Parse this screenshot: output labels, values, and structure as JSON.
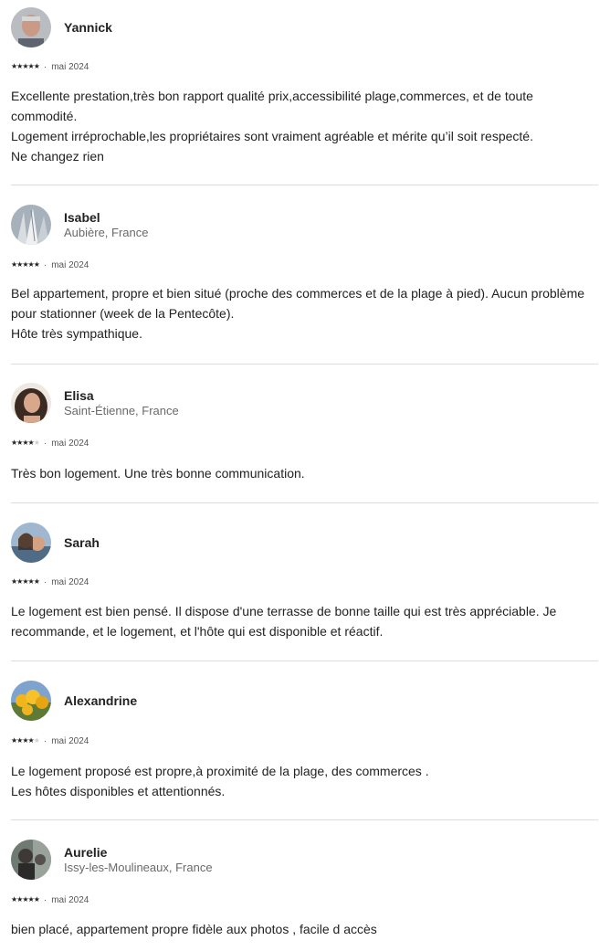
{
  "reviews": [
    {
      "name": "Yannick",
      "location": "",
      "rating": 5,
      "date": "mai 2024",
      "avatar": "person-photo",
      "text": [
        "Excellente prestation,très bon rapport qualité prix,accessibilité plage,commerces, et de toute commodité.",
        "Logement irréprochable,les propriétaires sont vraiment agréable et mérite qu’il soit respecté.",
        "Ne changez rien"
      ]
    },
    {
      "name": "Isabel",
      "location": "Aubière, France",
      "rating": 5,
      "date": "mai 2024",
      "avatar": "winter-tree-photo",
      "text": [
        "Bel appartement, propre et bien situé (proche des commerces et de la plage à pied). Aucun problème pour stationner (week de la Pentecôte).",
        "Hôte très sympathique."
      ]
    },
    {
      "name": "Elisa",
      "location": "Saint-Étienne, France",
      "rating": 4,
      "date": "mai 2024",
      "avatar": "person-photo",
      "text": [
        "Très bon logement. Une très bonne communication."
      ]
    },
    {
      "name": "Sarah",
      "location": "",
      "rating": 5,
      "date": "mai 2024",
      "avatar": "couple-photo",
      "text": [
        "Le logement est bien pensé. Il dispose d'une terrasse de bonne taille qui est très appréciable. Je recommande, et le logement, et l'hôte qui est disponible et réactif."
      ]
    },
    {
      "name": "Alexandrine",
      "location": "",
      "rating": 4,
      "date": "mai 2024",
      "avatar": "yellow-flowers-photo",
      "text": [
        "Le logement proposé est propre,à proximité de la plage, des commerces .",
        "Les hôtes disponibles et attentionnés."
      ]
    },
    {
      "name": "Aurelie",
      "location": "Issy-les-Moulineaux, France",
      "rating": 5,
      "date": "mai 2024",
      "avatar": "person-photo",
      "text": [
        "bien placé, appartement propre fidèle aux photos , facile d accès"
      ]
    }
  ],
  "star_char": "★",
  "separator": "·",
  "colors": {
    "text": "#222222",
    "secondary": "#6a6a6a",
    "divider": "#dddddd"
  }
}
